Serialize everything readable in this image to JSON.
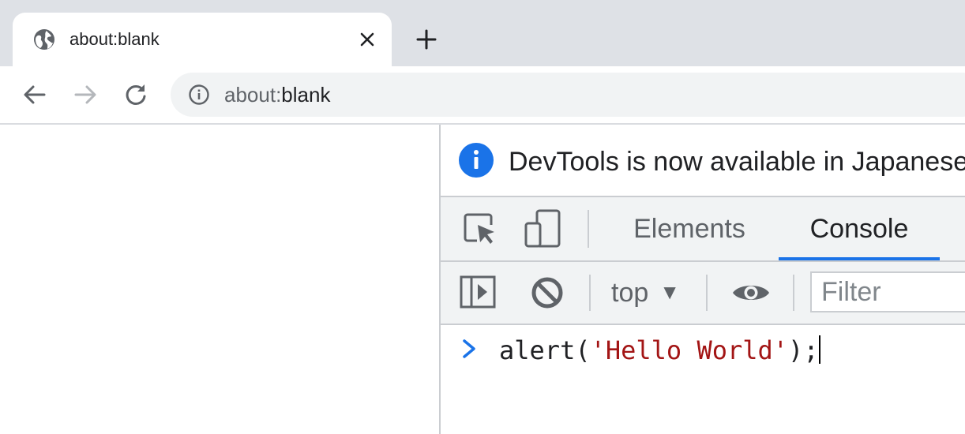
{
  "browser": {
    "tab": {
      "title": "about:blank"
    },
    "address_bar": {
      "scheme": "about:",
      "path": "blank"
    }
  },
  "devtools": {
    "infobar": {
      "message": "DevTools is now available in Japanese"
    },
    "tabs": [
      {
        "label": "Elements",
        "active": false
      },
      {
        "label": "Console",
        "active": true
      }
    ],
    "console_toolbar": {
      "context": "top",
      "filter_placeholder": "Filter"
    },
    "console_input": {
      "fn": "alert(",
      "string": "'Hello World'",
      "tail": ");"
    }
  },
  "colors": {
    "accent": "#1a73e8",
    "string": "#a31515",
    "chrome_bg": "#dee1e6",
    "panel_bg": "#f1f3f4"
  },
  "icons": [
    "globe-icon",
    "close-icon",
    "plus-icon",
    "back-arrow-icon",
    "forward-arrow-icon",
    "reload-icon",
    "info-icon",
    "inspect-element-icon",
    "device-toggle-icon",
    "sidebar-toggle-icon",
    "clear-console-icon",
    "eye-icon",
    "chevron-right-icon"
  ]
}
